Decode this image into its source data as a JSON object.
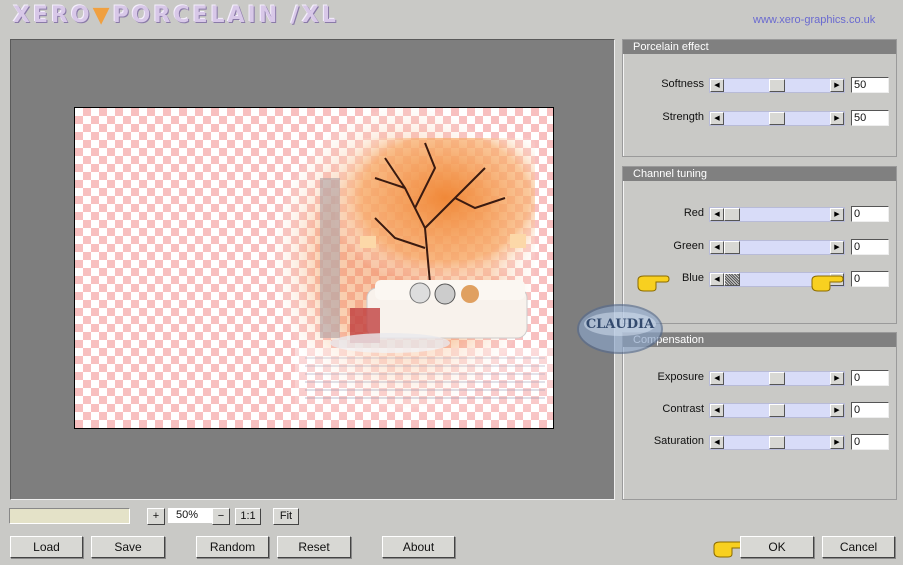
{
  "app": {
    "title_part1": "XERO",
    "title_part2": "PORCELAIN",
    "title_part3": "/XL",
    "url": "www.xero-graphics.co.uk"
  },
  "panels": {
    "porcelain": {
      "title": "Porcelain effect",
      "sliders": [
        {
          "label": "Softness",
          "value": "50",
          "level": 0.5
        },
        {
          "label": "Strength",
          "value": "50",
          "level": 0.5
        }
      ]
    },
    "channel": {
      "title": "Channel tuning",
      "sliders": [
        {
          "label": "Red",
          "value": "0",
          "level": 0.0
        },
        {
          "label": "Green",
          "value": "0",
          "level": 0.0
        },
        {
          "label": "Blue",
          "value": "0",
          "level": 0.0
        }
      ]
    },
    "compensation": {
      "title": "Compensation",
      "sliders": [
        {
          "label": "Exposure",
          "value": "0",
          "level": 0.5
        },
        {
          "label": "Contrast",
          "value": "0",
          "level": 0.5
        },
        {
          "label": "Saturation",
          "value": "0",
          "level": 0.5
        }
      ]
    }
  },
  "zoom": {
    "plus": "+",
    "value": "50%",
    "minus": "−",
    "one_to_one": "1:1",
    "fit": "Fit"
  },
  "buttons": {
    "load": "Load",
    "save": "Save",
    "random": "Random",
    "reset": "Reset",
    "about": "About",
    "ok": "OK",
    "cancel": "Cancel"
  },
  "watermark": {
    "text": "CLAUDIA"
  },
  "colors": {
    "slider_track": "#d8dcf8",
    "panel_header": "#808080",
    "checker": "#f8c0c0",
    "url": "#6a6ad0"
  }
}
